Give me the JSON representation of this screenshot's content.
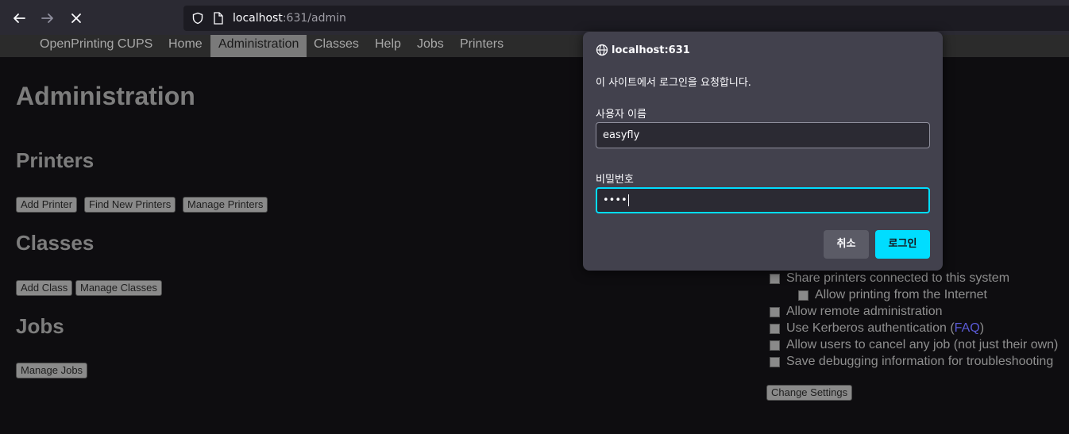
{
  "browser": {
    "url_host": "localhost",
    "url_rest": ":631/admin"
  },
  "cups_nav": {
    "brand": "OpenPrinting CUPS",
    "items": [
      "Home",
      "Administration",
      "Classes",
      "Help",
      "Jobs",
      "Printers"
    ],
    "active": "Administration"
  },
  "page": {
    "title": "Administration",
    "printers": {
      "heading": "Printers",
      "buttons": [
        "Add Printer",
        "Find New Printers",
        "Manage Printers"
      ]
    },
    "classes": {
      "heading": "Classes",
      "buttons": [
        "Add Class",
        "Manage Classes"
      ]
    },
    "jobs": {
      "heading": "Jobs",
      "buttons": [
        "Manage Jobs"
      ]
    },
    "server_settings": {
      "options": [
        "Share printers connected to this system",
        "Allow printing from the Internet",
        "Allow remote administration",
        "Use Kerberos authentication (",
        "Allow users to cancel any job (not just their own)",
        "Save debugging information for troubleshooting"
      ],
      "faq_link": "FAQ",
      "faq_close": ")",
      "change_button": "Change Settings"
    }
  },
  "auth_dialog": {
    "host": "localhost:631",
    "message": "이 사이트에서 로그인을 요청합니다.",
    "username_label": "사용자 이름",
    "username_value": "easyfly",
    "password_label": "비밀번호",
    "password_value": "••••",
    "cancel_label": "취소",
    "login_label": "로그인"
  },
  "colors": {
    "accent": "#00ddff",
    "dialog_bg": "#42414d",
    "page_bg": "#0e0d10"
  },
  "icons": [
    "back-arrow-icon",
    "forward-arrow-icon",
    "stop-icon",
    "shield-icon",
    "page-icon",
    "globe-icon"
  ]
}
